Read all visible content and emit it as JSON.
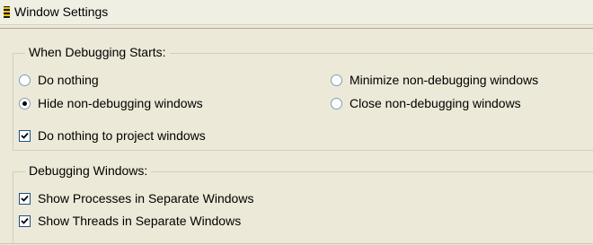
{
  "window": {
    "title": "Window Settings",
    "icon": "debug-window-icon"
  },
  "when_debugging": {
    "legend": "When Debugging Starts:",
    "options": [
      {
        "label": "Do nothing",
        "selected": false
      },
      {
        "label": "Hide non-debugging windows",
        "selected": true
      },
      {
        "label": "Minimize non-debugging windows",
        "selected": false
      },
      {
        "label": "Close non-debugging windows",
        "selected": false
      }
    ],
    "project_windows": {
      "label": "Do nothing to project windows",
      "checked": true
    }
  },
  "debugging_windows": {
    "legend": "Debugging Windows:",
    "options": [
      {
        "label": "Show Processes in Separate Windows",
        "checked": true
      },
      {
        "label": "Show Threads in Separate Windows",
        "checked": true
      }
    ]
  }
}
